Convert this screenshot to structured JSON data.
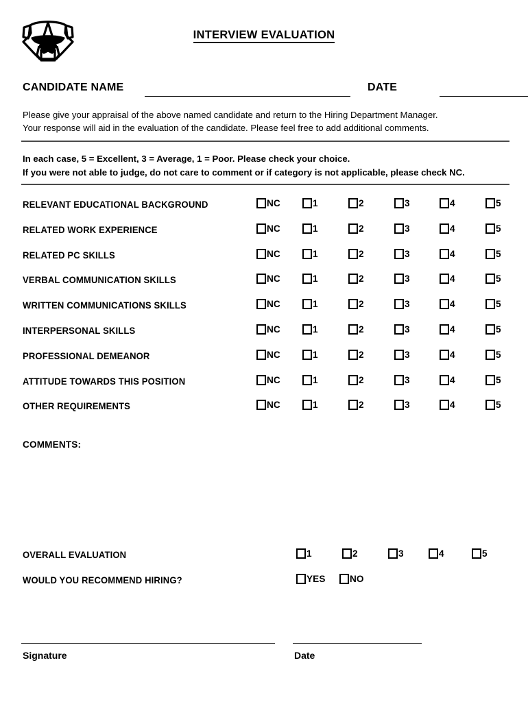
{
  "header": {
    "logo_icon": "bulldog-mascot-icon",
    "title": "INTERVIEW EVALUATION"
  },
  "candidate": {
    "name_label": "CANDIDATE NAME",
    "name_value": "",
    "date_label": "DATE",
    "date_value": ""
  },
  "intro": {
    "line1": "Please give your appraisal of the above named candidate and return to the Hiring Department Manager.",
    "line2": "Your response will aid in the evaluation of the candidate.  Please feel free to add additional comments."
  },
  "scale": {
    "line1": "In each case, 5 = Excellent, 3 = Average, 1 = Poor.  Please check your choice.",
    "line2": "If you were not able to judge, do not care to comment or if category is not applicable, please check NC."
  },
  "rating_options": [
    "NC",
    "1",
    "2",
    "3",
    "4",
    "5"
  ],
  "criteria": [
    {
      "label": "RELEVANT EDUCATIONAL BACKGROUND"
    },
    {
      "label": "RELATED WORK EXPERIENCE"
    },
    {
      "label": "RELATED PC SKILLS"
    },
    {
      "label": "VERBAL COMMUNICATION SKILLS"
    },
    {
      "label": "WRITTEN COMMUNICATIONS SKILLS"
    },
    {
      "label": "INTERPERSONAL SKILLS"
    },
    {
      "label": "PROFESSIONAL DEMEANOR"
    },
    {
      "label": "ATTITUDE TOWARDS THIS POSITION"
    },
    {
      "label": "OTHER REQUIREMENTS"
    }
  ],
  "comments": {
    "label": "COMMENTS:",
    "value": ""
  },
  "overall": {
    "eval_label": "OVERALL EVALUATION",
    "eval_options": [
      "1",
      "2",
      "3",
      "4",
      "5"
    ],
    "recommend_label": "WOULD YOU RECOMMEND HIRING?",
    "recommend_options": [
      "YES",
      "NO"
    ]
  },
  "footer": {
    "signature_label": "Signature",
    "date_label": "Date"
  }
}
